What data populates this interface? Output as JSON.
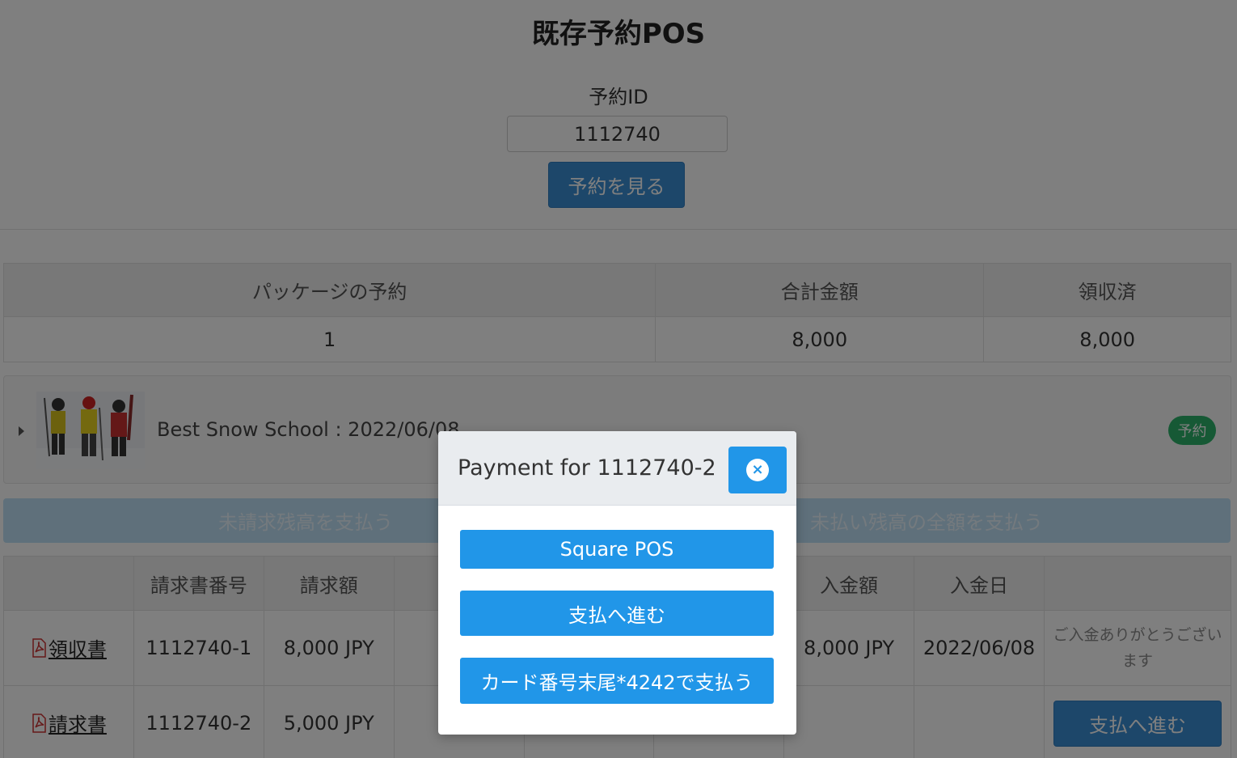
{
  "page": {
    "title": "既存予約POS",
    "id_label": "予約ID",
    "id_value": "1112740",
    "view_button": "予約を見る"
  },
  "summary": {
    "headers": [
      "パッケージの予約",
      "合計金額",
      "領収済"
    ],
    "values": [
      "1",
      "8,000",
      "8,000"
    ]
  },
  "package": {
    "name": "Best Snow School : 2022/06/08",
    "badge": "予約"
  },
  "pay_buttons": {
    "unbilled": "未請求残高を支払う",
    "full_balance": "未払い残高の全額を支払う"
  },
  "invoices": {
    "headers": [
      "",
      "請求書番号",
      "請求額",
      "",
      "",
      "",
      "入金額",
      "入金日",
      ""
    ],
    "rows": [
      {
        "doc": "領収書",
        "number": "1112740-1",
        "amount": "8,000 JPY",
        "paid": "8,000 JPY",
        "date": "2022/06/08",
        "status": "ご入金ありがとうございます"
      },
      {
        "doc": "請求書",
        "number": "1112740-2",
        "amount": "5,000 JPY",
        "paid": "",
        "date": "",
        "action": "支払へ進む"
      }
    ]
  },
  "modal": {
    "title": "Payment for 1112740-2",
    "close_icon": "×",
    "buttons": [
      "Square POS",
      "支払へ進む",
      "カード番号末尾*4242で支払う"
    ]
  },
  "colors": {
    "primary": "#3a8fd4",
    "modal_button": "#2196e8",
    "badge": "#2cb36a",
    "overlay": "rgba(0,0,0,0.5)"
  }
}
